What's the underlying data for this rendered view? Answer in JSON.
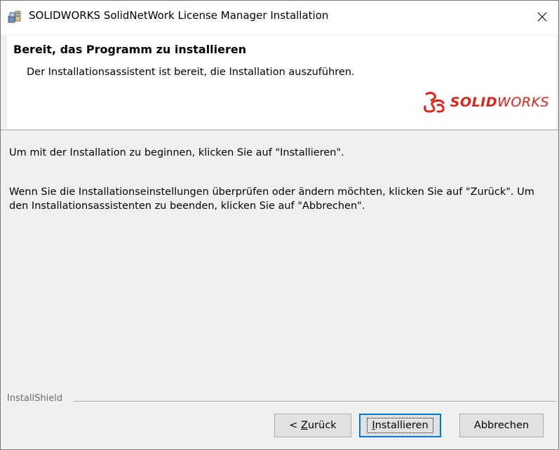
{
  "window": {
    "title": "SOLIDWORKS SolidNetWork License Manager Installation",
    "close_glyph": "✕"
  },
  "header": {
    "title": "Bereit, das Programm zu installieren",
    "subtitle": "Der Installationsassistent ist bereit, die Installation auszuführen.",
    "logo_bold": "SOLID",
    "logo_light": "WORKS",
    "logo_color": "#e2231a"
  },
  "body": {
    "line1": "Um mit der Installation zu beginnen, klicken Sie auf \"Installieren\".",
    "line2": "Wenn Sie die Installationseinstellungen überprüfen oder ändern möchten, klicken Sie auf \"Zurück\". Um den Installationsassistenten zu beenden, klicken Sie auf \"Abbrechen\"."
  },
  "footer": {
    "brand": "InstallShield"
  },
  "buttons": {
    "back": {
      "prefix": "< ",
      "accel": "Z",
      "rest": "urück"
    },
    "install": {
      "accel": "I",
      "rest": "nstallieren"
    },
    "cancel": {
      "label": "Abbrechen"
    }
  }
}
